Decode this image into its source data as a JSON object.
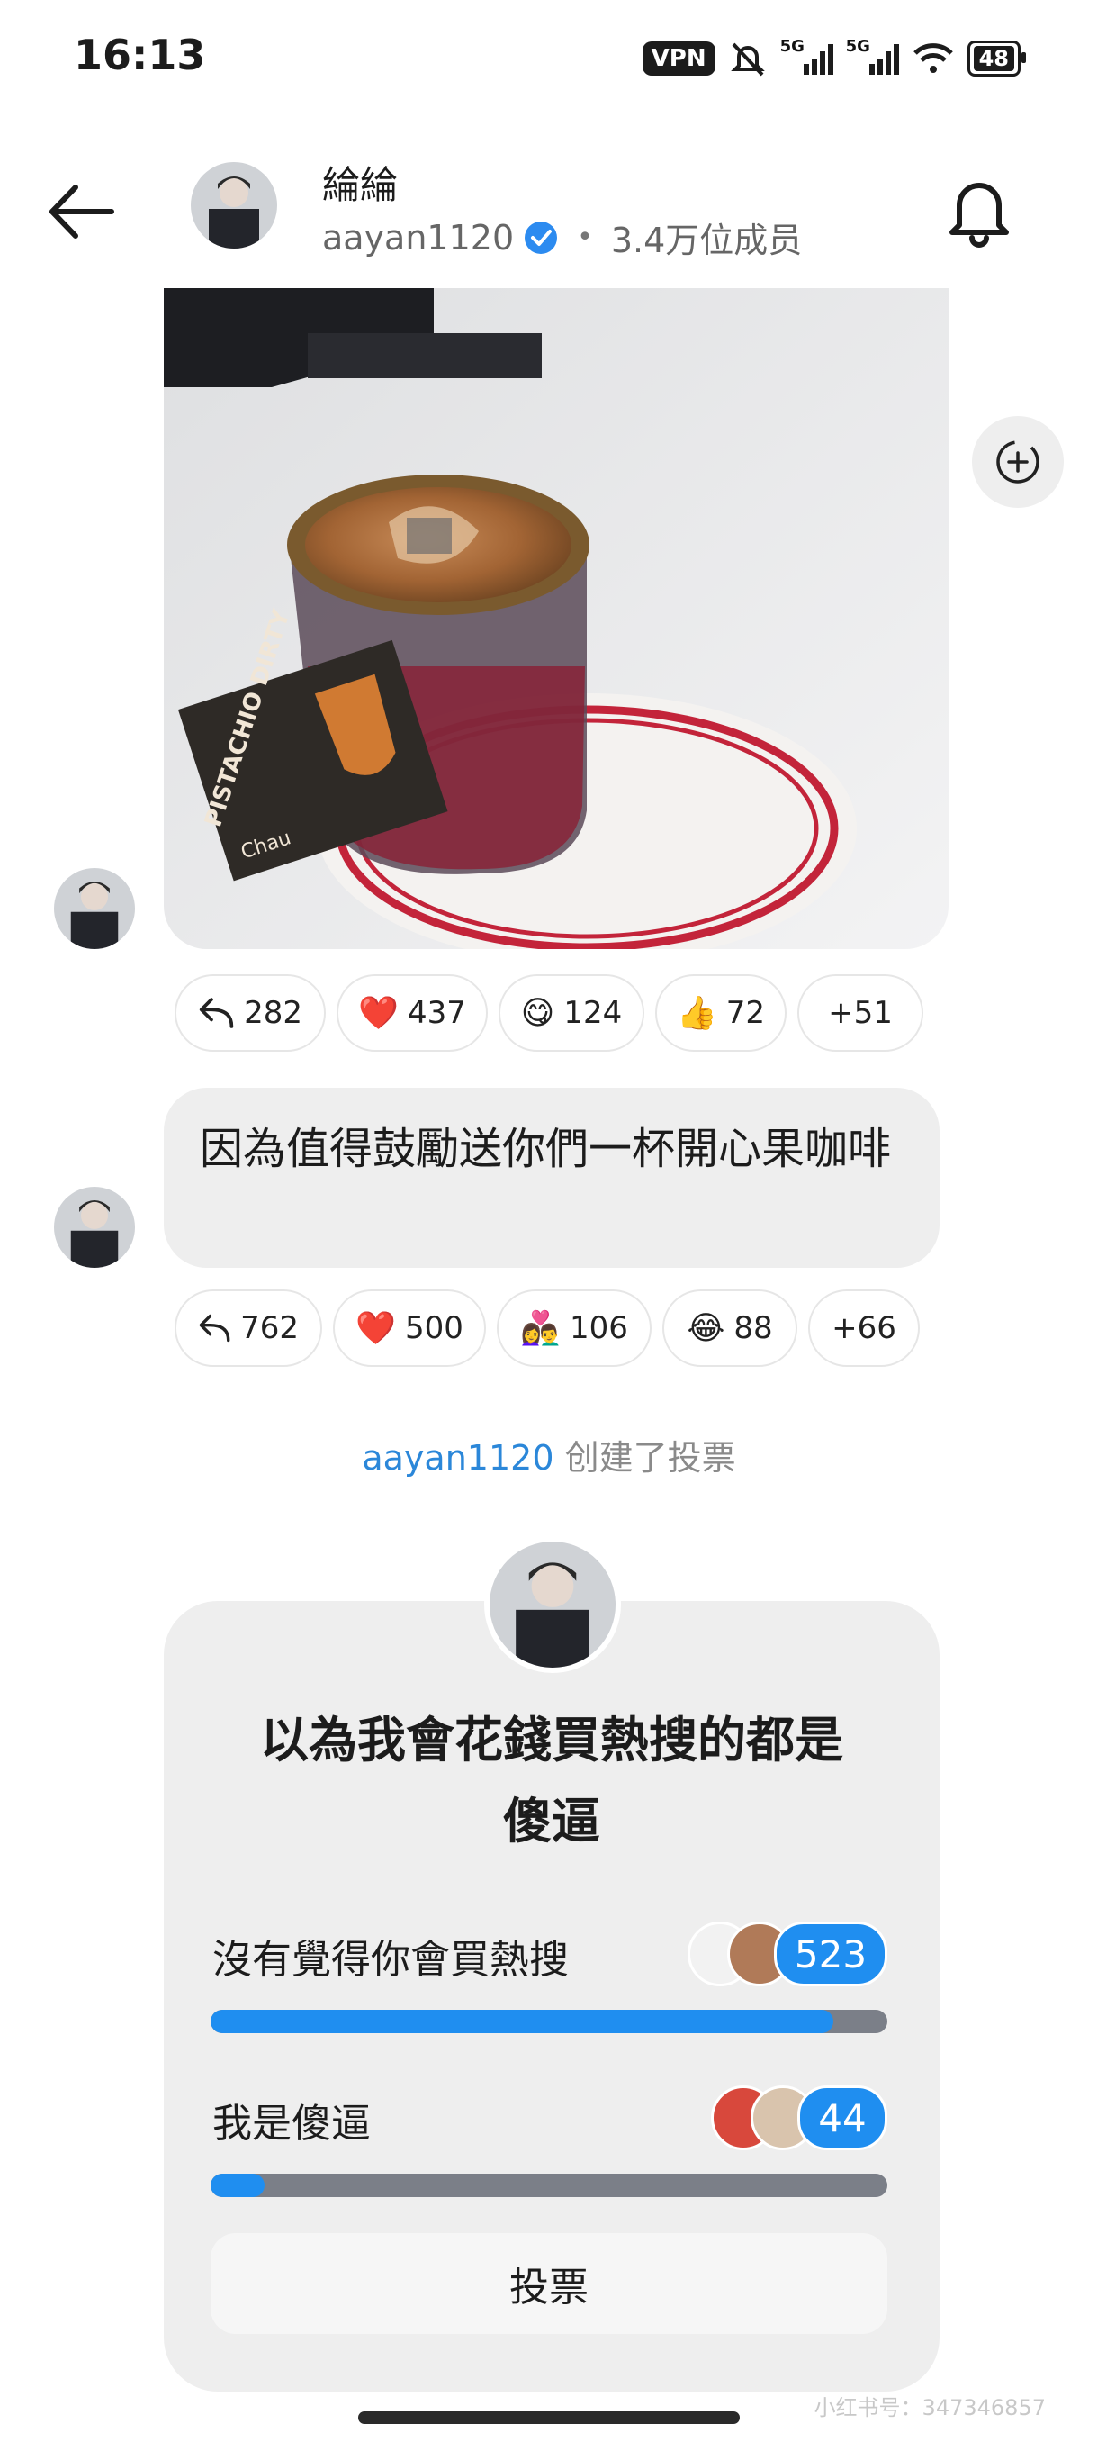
{
  "status_bar": {
    "time": "16:13",
    "vpn": "VPN",
    "signal1_label": "5G",
    "signal2_label": "5G",
    "battery": "48"
  },
  "header": {
    "name": "綸綸",
    "username": "aayan1120",
    "members": "3.4万位成员"
  },
  "messages": {
    "image_card_text": "PISTACHIO DIRTY",
    "image_card_brand": "Chau",
    "reactions_1": [
      {
        "icon": "reply-icon",
        "emoji": "",
        "count": "282"
      },
      {
        "icon": "heart",
        "emoji": "❤️",
        "count": "437"
      },
      {
        "icon": "yum",
        "emoji": "😋",
        "count": "124"
      },
      {
        "icon": "thumbs-up",
        "emoji": "👍",
        "count": "72"
      },
      {
        "icon": "more",
        "emoji": "",
        "count": "+51"
      }
    ],
    "text_message": "因為值得鼓勵送你們一杯開心果咖啡",
    "reactions_2": [
      {
        "icon": "reply-icon",
        "emoji": "",
        "count": "762"
      },
      {
        "icon": "heart",
        "emoji": "❤️",
        "count": "500"
      },
      {
        "icon": "couple",
        "emoji": "👩‍❤️‍👨",
        "count": "106"
      },
      {
        "icon": "laugh",
        "emoji": "😂",
        "count": "88"
      },
      {
        "icon": "more",
        "emoji": "",
        "count": "+66"
      }
    ]
  },
  "system_note": {
    "user": "aayan1120",
    "action": " 创建了投票"
  },
  "poll": {
    "question_line1": "以為我會花錢買熱搜的都是",
    "question_line2": "傻逼",
    "options": [
      {
        "label": "沒有覺得你會買熱搜",
        "count": "523",
        "fraction": 0.92
      },
      {
        "label": "我是傻逼",
        "count": "44",
        "fraction": 0.08
      }
    ],
    "vote_button": "投票"
  },
  "watermark": "小红书号：347346857",
  "colors": {
    "accent": "#1f8ef0",
    "bubble": "#eeeeee",
    "muted": "#8a8a8a"
  }
}
